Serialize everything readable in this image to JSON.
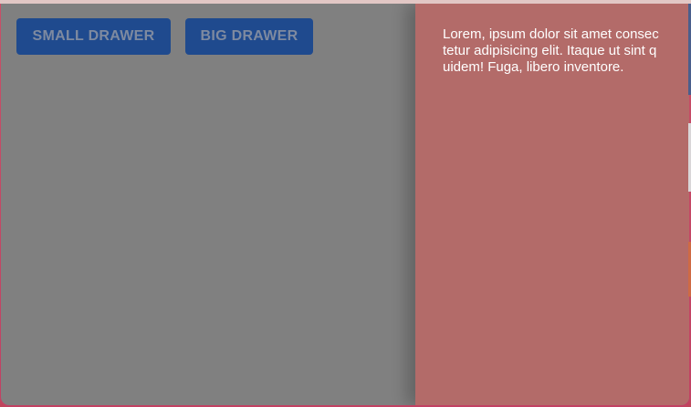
{
  "buttons": {
    "small_drawer": "Small Drawer",
    "big_drawer": "Big Drawer"
  },
  "drawer": {
    "text": "Lorem, ipsum dolor sit amet consectetur adipisicing elit. Itaque ut sint quidem! Fuga, libero inventore."
  },
  "colors": {
    "overlay": "#808080",
    "button_bg": "#1f4a8e",
    "drawer_bg": "#b36b69",
    "desktop_bg": "#c0455a"
  }
}
